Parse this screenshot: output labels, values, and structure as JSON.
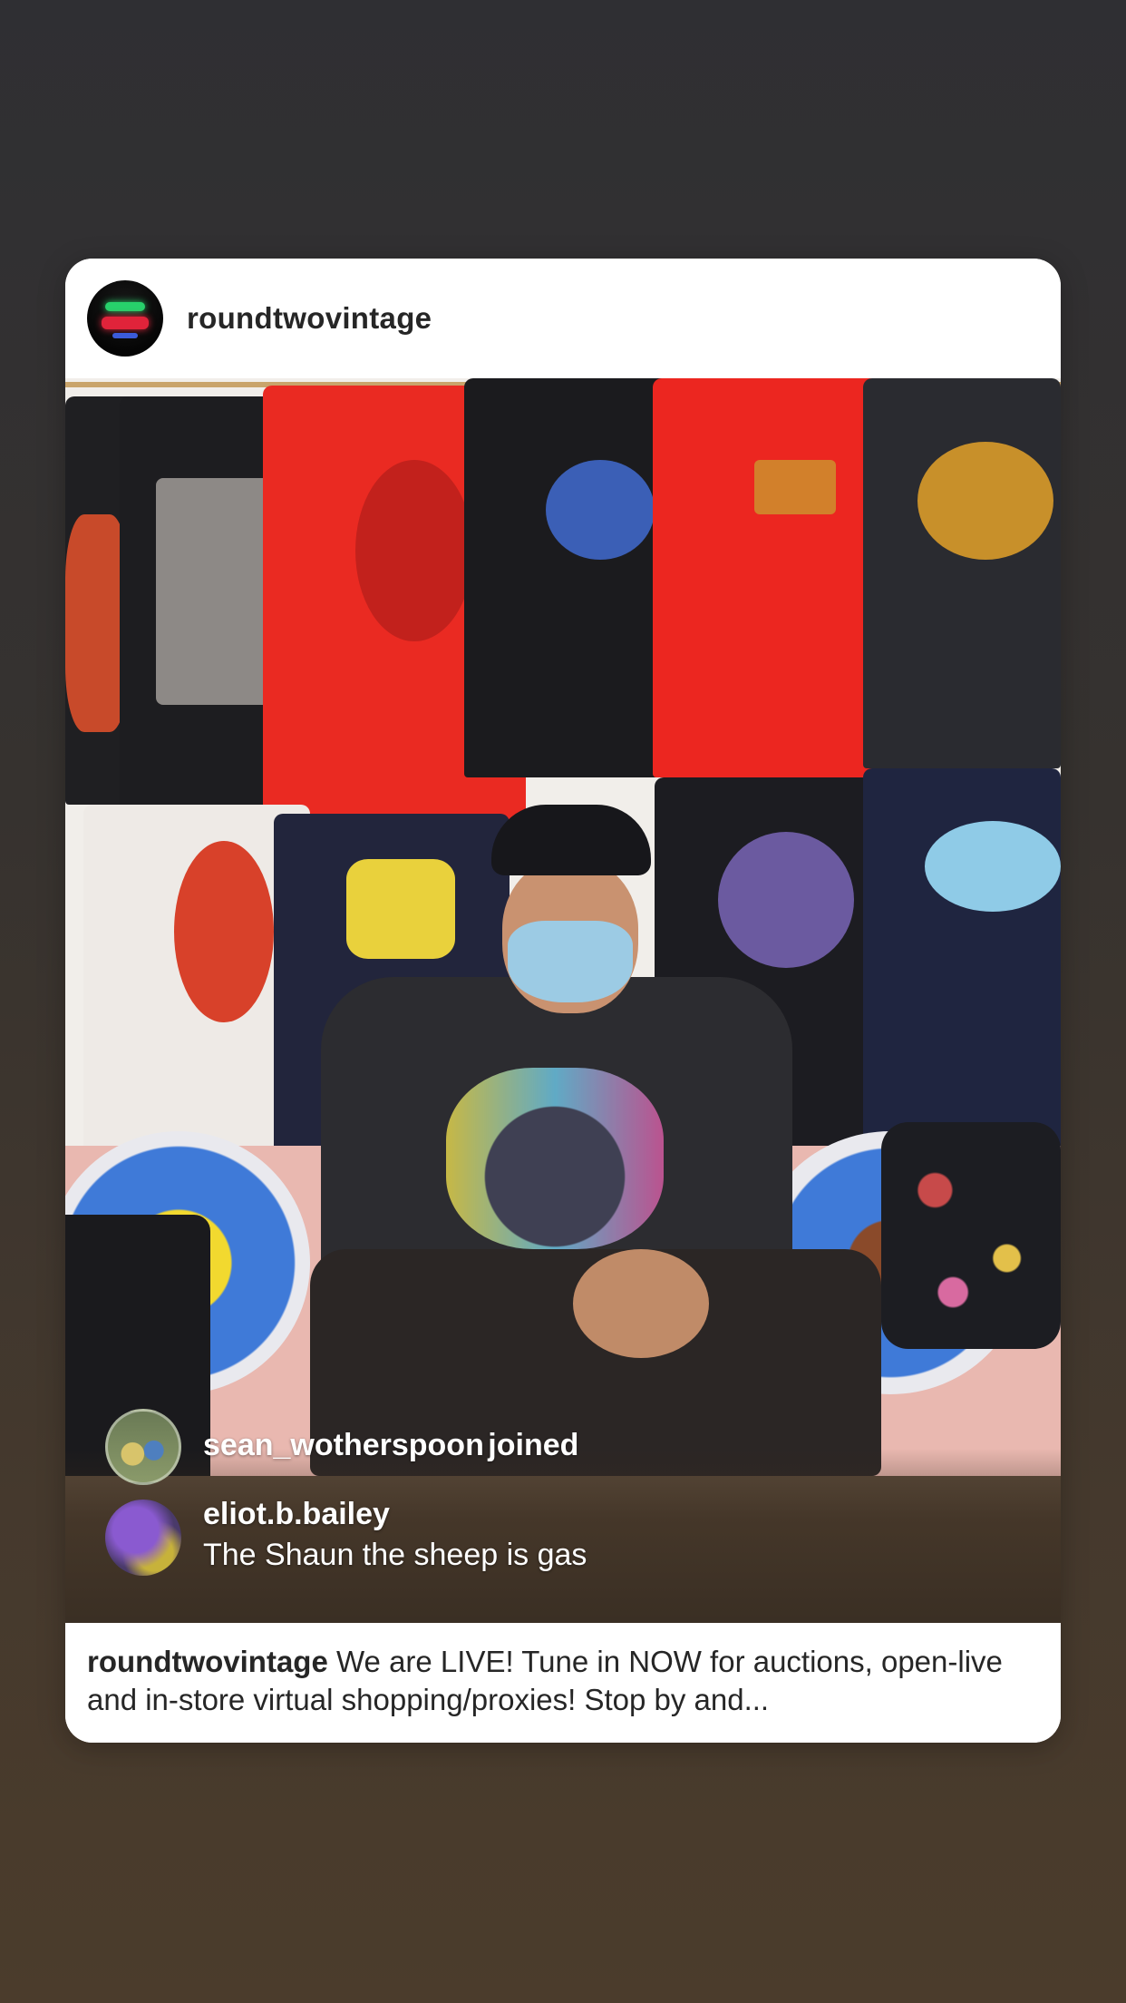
{
  "post": {
    "username": "roundtwovintage",
    "avatar_icon": "neon-sign-avatar"
  },
  "live_comments": [
    {
      "username": "sean_wotherspoon",
      "message": "joined"
    },
    {
      "username": "eliot.b.bailey",
      "message": "The Shaun the sheep is gas"
    }
  ],
  "caption": {
    "username": "roundtwovintage",
    "text": "We are LIVE! Tune in NOW for auctions, open-live and in-store virtual shopping/proxies! Stop by and..."
  }
}
